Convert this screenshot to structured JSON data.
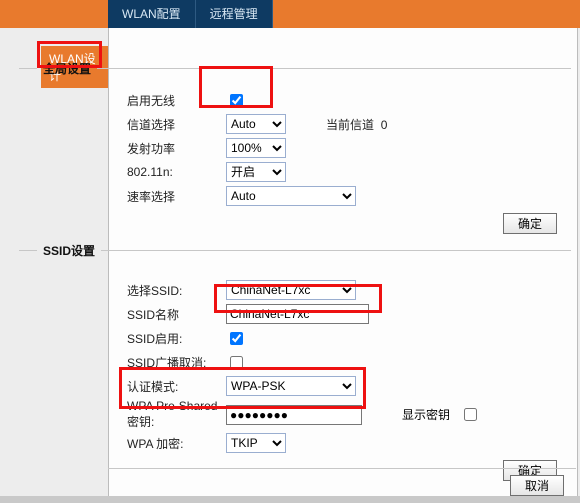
{
  "header": {
    "tabs": [
      "WLAN配置",
      "远程管理"
    ],
    "side_tab": "WLAN设计"
  },
  "global": {
    "legend": "全局设置",
    "enable_wireless_label": "启用无线",
    "enable_wireless_checked": true,
    "channel_select_label": "信道选择",
    "channel_select_value": "Auto",
    "current_channel_label": "当前信道",
    "current_channel_value": "0",
    "tx_power_label": "发射功率",
    "tx_power_value": "100%",
    "dot11n_label": "802.11n:",
    "dot11n_value": "开启",
    "rate_label": "速率选择",
    "rate_value": "Auto",
    "confirm": "确定"
  },
  "ssid": {
    "legend": "SSID设置",
    "select_ssid_label": "选择SSID:",
    "select_ssid_value": "ChinaNet-L7xc",
    "ssid_name_label": "SSID名称",
    "ssid_name_value": "ChinaNet-L7xc",
    "ssid_enable_label": "SSID启用:",
    "ssid_enable_checked": true,
    "ssid_bcast_cancel_label": "SSID广播取消:",
    "ssid_bcast_cancel_checked": false,
    "auth_mode_label": "认证模式:",
    "auth_mode_value": "WPA-PSK",
    "psk_label": "WPA Pre-Shared 密钥:",
    "psk_value": "●●●●●●●●",
    "show_key_label": "显示密钥",
    "show_key_checked": false,
    "wpa_enc_label": "WPA 加密:",
    "wpa_enc_value": "TKIP",
    "confirm": "确定"
  },
  "footer": {
    "cancel": "取消"
  }
}
